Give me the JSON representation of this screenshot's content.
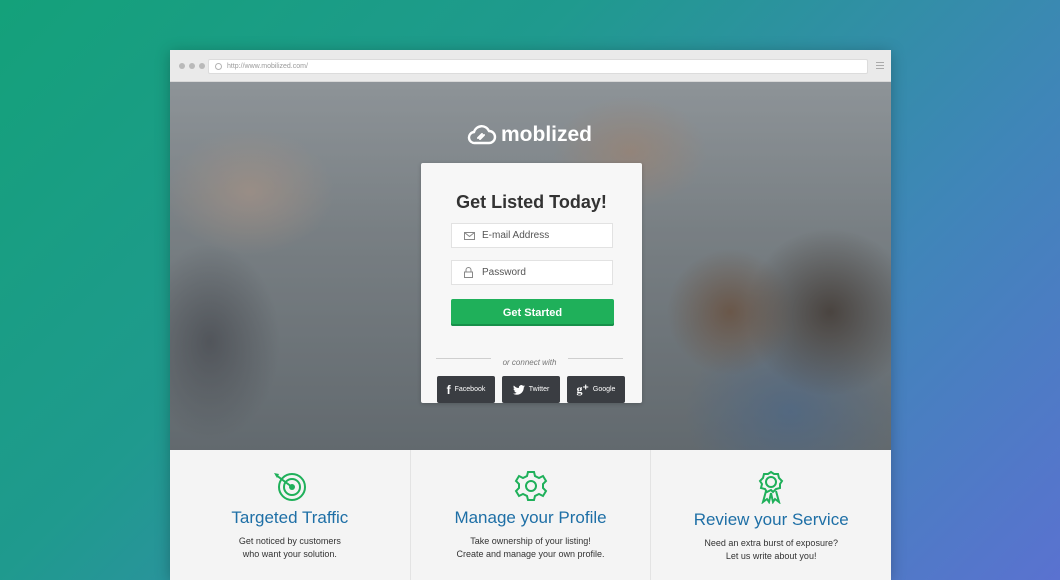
{
  "browser": {
    "url": "http://www.mobilized.com/"
  },
  "hero": {
    "logo_text": "moblized"
  },
  "form": {
    "title": "Get Listed Today!",
    "email_placeholder": "E-mail Address",
    "password_placeholder": "Password",
    "submit_label": "Get Started",
    "divider_text": "or connect with",
    "social": [
      {
        "label": "Facebook",
        "icon": "facebook-icon"
      },
      {
        "label": "Twitter",
        "icon": "twitter-icon"
      },
      {
        "label": "Google",
        "icon": "google-plus-icon"
      }
    ]
  },
  "features": [
    {
      "title": "Targeted Traffic",
      "description": "Get noticed by customers\nwho want your solution.",
      "icon": "target-icon"
    },
    {
      "title": "Manage your Profile",
      "description": "Take ownership of your listing!\nCreate and manage your own profile.",
      "icon": "gear-icon"
    },
    {
      "title": "Review your Service",
      "description": "Need an extra burst of exposure?\nLet us write about you!",
      "icon": "award-ribbon-icon"
    }
  ],
  "colors": {
    "accent_green": "#1fb05a",
    "feature_icon_green": "#1fb05a",
    "feature_title_blue": "#1e6fa6",
    "social_button": "#3a3d42"
  }
}
